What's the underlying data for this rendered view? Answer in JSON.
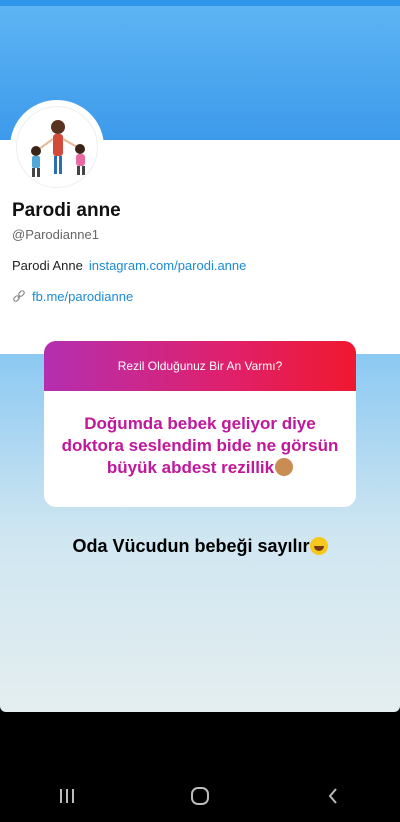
{
  "profile": {
    "name": "Parodi anne",
    "handle": "@Parodianne1",
    "bio_name": "Parodi Anne",
    "bio_link": "instagram.com/parodi.anne",
    "website": "fb.me/parodianne"
  },
  "question_box": {
    "question": "Rezil Olduğunuz Bir An Varmı?",
    "answer": "Doğumda bebek geliyor diye doktora seslendim bide ne görsün büyük abdest rezillik"
  },
  "caption": "Oda Vücudun bebeği sayılır",
  "icons": {
    "link": "link-icon",
    "answer_emoji": "see-no-evil-monkey-icon",
    "caption_emoji": "rolling-laughing-icon",
    "nav_recents": "recents-icon",
    "nav_home": "home-icon",
    "nav_back": "back-icon"
  },
  "colors": {
    "header_blue": "#3d9aeb",
    "link_blue": "#1b8bd6",
    "answer_magenta": "#c0179b",
    "gradient_start": "#b42fb0",
    "gradient_end": "#f0182e"
  }
}
